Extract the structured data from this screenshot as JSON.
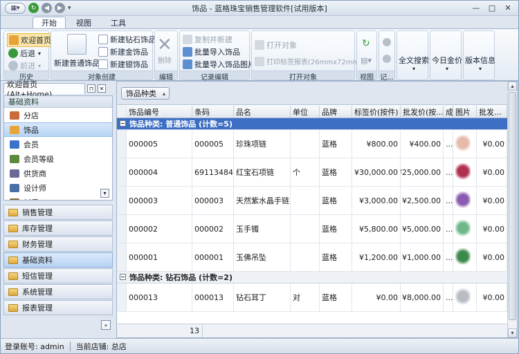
{
  "window": {
    "title": "饰品 - 蓝格珠宝销售管理软件[试用版本]"
  },
  "tabs": [
    {
      "label": "开始",
      "active": true
    },
    {
      "label": "视图",
      "active": false
    },
    {
      "label": "工具",
      "active": false
    }
  ],
  "ribbon": {
    "history": {
      "caption": "历史",
      "home": "欢迎首页",
      "back": "后退",
      "forward": "前进"
    },
    "create": {
      "caption": "对象创建",
      "new_normal": "新建普通饰品",
      "new_diamond": "新建钻石饰品",
      "new_gold": "新建金饰品",
      "new_silver": "新建银饰品"
    },
    "edit": {
      "caption": "编辑",
      "delete": "删除"
    },
    "records": {
      "caption": "记录编辑",
      "copy_new": "复制并新建",
      "batch_import": "批量导入饰品",
      "batch_import_pic": "批量导入饰品图片"
    },
    "open": {
      "caption": "打开对象",
      "open_obj": "打开对象",
      "print_label": "打印标签报表(26mmx72mm)"
    },
    "view": {
      "caption": "视图"
    },
    "rec": {
      "caption": "记..."
    },
    "fulltext": "全文搜索",
    "gold_price": "今日金价",
    "version": "版本信息"
  },
  "left": {
    "tab_label": "欢迎首页 (Alt+Home)",
    "panel_title": "基础资料",
    "nav_items": [
      {
        "label": "分店",
        "icon": "house-icon",
        "color": "#c96b3a",
        "selected": false
      },
      {
        "label": "饰品",
        "icon": "jewelry-icon",
        "color": "#e7a53c",
        "selected": true
      },
      {
        "label": "会员",
        "icon": "member-icon",
        "color": "#3a73c9",
        "selected": false
      },
      {
        "label": "会员等级",
        "icon": "member-level-icon",
        "color": "#5a8a3a",
        "selected": false
      },
      {
        "label": "供货商",
        "icon": "supplier-icon",
        "color": "#6a6a9a",
        "selected": false
      },
      {
        "label": "设计师",
        "icon": "designer-icon",
        "color": "#4a6ea8",
        "selected": false
      },
      {
        "label": "材质",
        "icon": "material-icon",
        "color": "#8a6a3a",
        "selected": false
      }
    ],
    "categories": [
      {
        "label": "销售管理",
        "selected": false
      },
      {
        "label": "库存管理",
        "selected": false
      },
      {
        "label": "财务管理",
        "selected": false
      },
      {
        "label": "基础资料",
        "selected": true
      },
      {
        "label": "短信管理",
        "selected": false
      },
      {
        "label": "系统管理",
        "selected": false
      },
      {
        "label": "报表管理",
        "selected": false
      }
    ]
  },
  "grid": {
    "group_chip": "饰品种类",
    "columns": [
      "饰品编号",
      "条码",
      "品名",
      "单位",
      "品牌",
      "标签价(按件)",
      "批发价(按...",
      "成",
      "图片",
      "批发..."
    ],
    "groups": [
      {
        "label": "饰品种类: 普通饰品 (计数=5)",
        "selected": true,
        "rows": [
          {
            "id": "000005",
            "barcode": "000005",
            "name": "珍珠项链",
            "unit": "",
            "brand": "蓝格",
            "tag_price": "¥800.00",
            "wholesale": "¥400.00",
            "cost": "...",
            "pic_color": "#e6b9a8",
            "pic": "pearl-necklace-icon",
            "wholesale2": "¥0.00"
          },
          {
            "id": "000004",
            "barcode": "69113484...",
            "name": "红宝石项链",
            "unit": "个",
            "brand": "蓝格",
            "tag_price": "¥30,000.00",
            "wholesale": "¥25,000.00",
            "cost": "...",
            "pic_color": "#b03050",
            "pic": "ruby-necklace-icon",
            "wholesale2": "¥0.00"
          },
          {
            "id": "000003",
            "barcode": "000003",
            "name": "天然紫水晶手链",
            "unit": "",
            "brand": "蓝格",
            "tag_price": "¥3,000.00",
            "wholesale": "¥2,500.00",
            "cost": "...",
            "pic_color": "#8b5ab0",
            "pic": "amethyst-bracelet-icon",
            "wholesale2": "¥0.00"
          },
          {
            "id": "000002",
            "barcode": "000002",
            "name": "玉手镯",
            "unit": "",
            "brand": "蓝格",
            "tag_price": "¥5,800.00",
            "wholesale": "¥5,000.00",
            "cost": "...",
            "pic_color": "#6fb88a",
            "pic": "jade-bangle-icon",
            "wholesale2": "¥0.00"
          },
          {
            "id": "000001",
            "barcode": "000001",
            "name": "玉佛吊坠",
            "unit": "",
            "brand": "蓝格",
            "tag_price": "¥1,200.00",
            "wholesale": "¥1,000.00",
            "cost": "...",
            "pic_color": "#3c8a4a",
            "pic": "jade-buddha-icon",
            "wholesale2": "¥0.00"
          }
        ]
      },
      {
        "label": "饰品种类: 钻石饰品 (计数=2)",
        "selected": false,
        "rows": [
          {
            "id": "000013",
            "barcode": "000013",
            "name": "钻石耳丁",
            "unit": "对",
            "brand": "蓝格",
            "tag_price": "¥0.00",
            "wholesale": "¥8,000.00",
            "cost": "...",
            "pic_color": "#b8bcc4",
            "pic": "diamond-earring-icon",
            "wholesale2": "¥0.00"
          }
        ]
      }
    ],
    "footer_count": "13"
  },
  "status": {
    "account": "登录账号: admin",
    "store": "当前店铺: 总店"
  }
}
